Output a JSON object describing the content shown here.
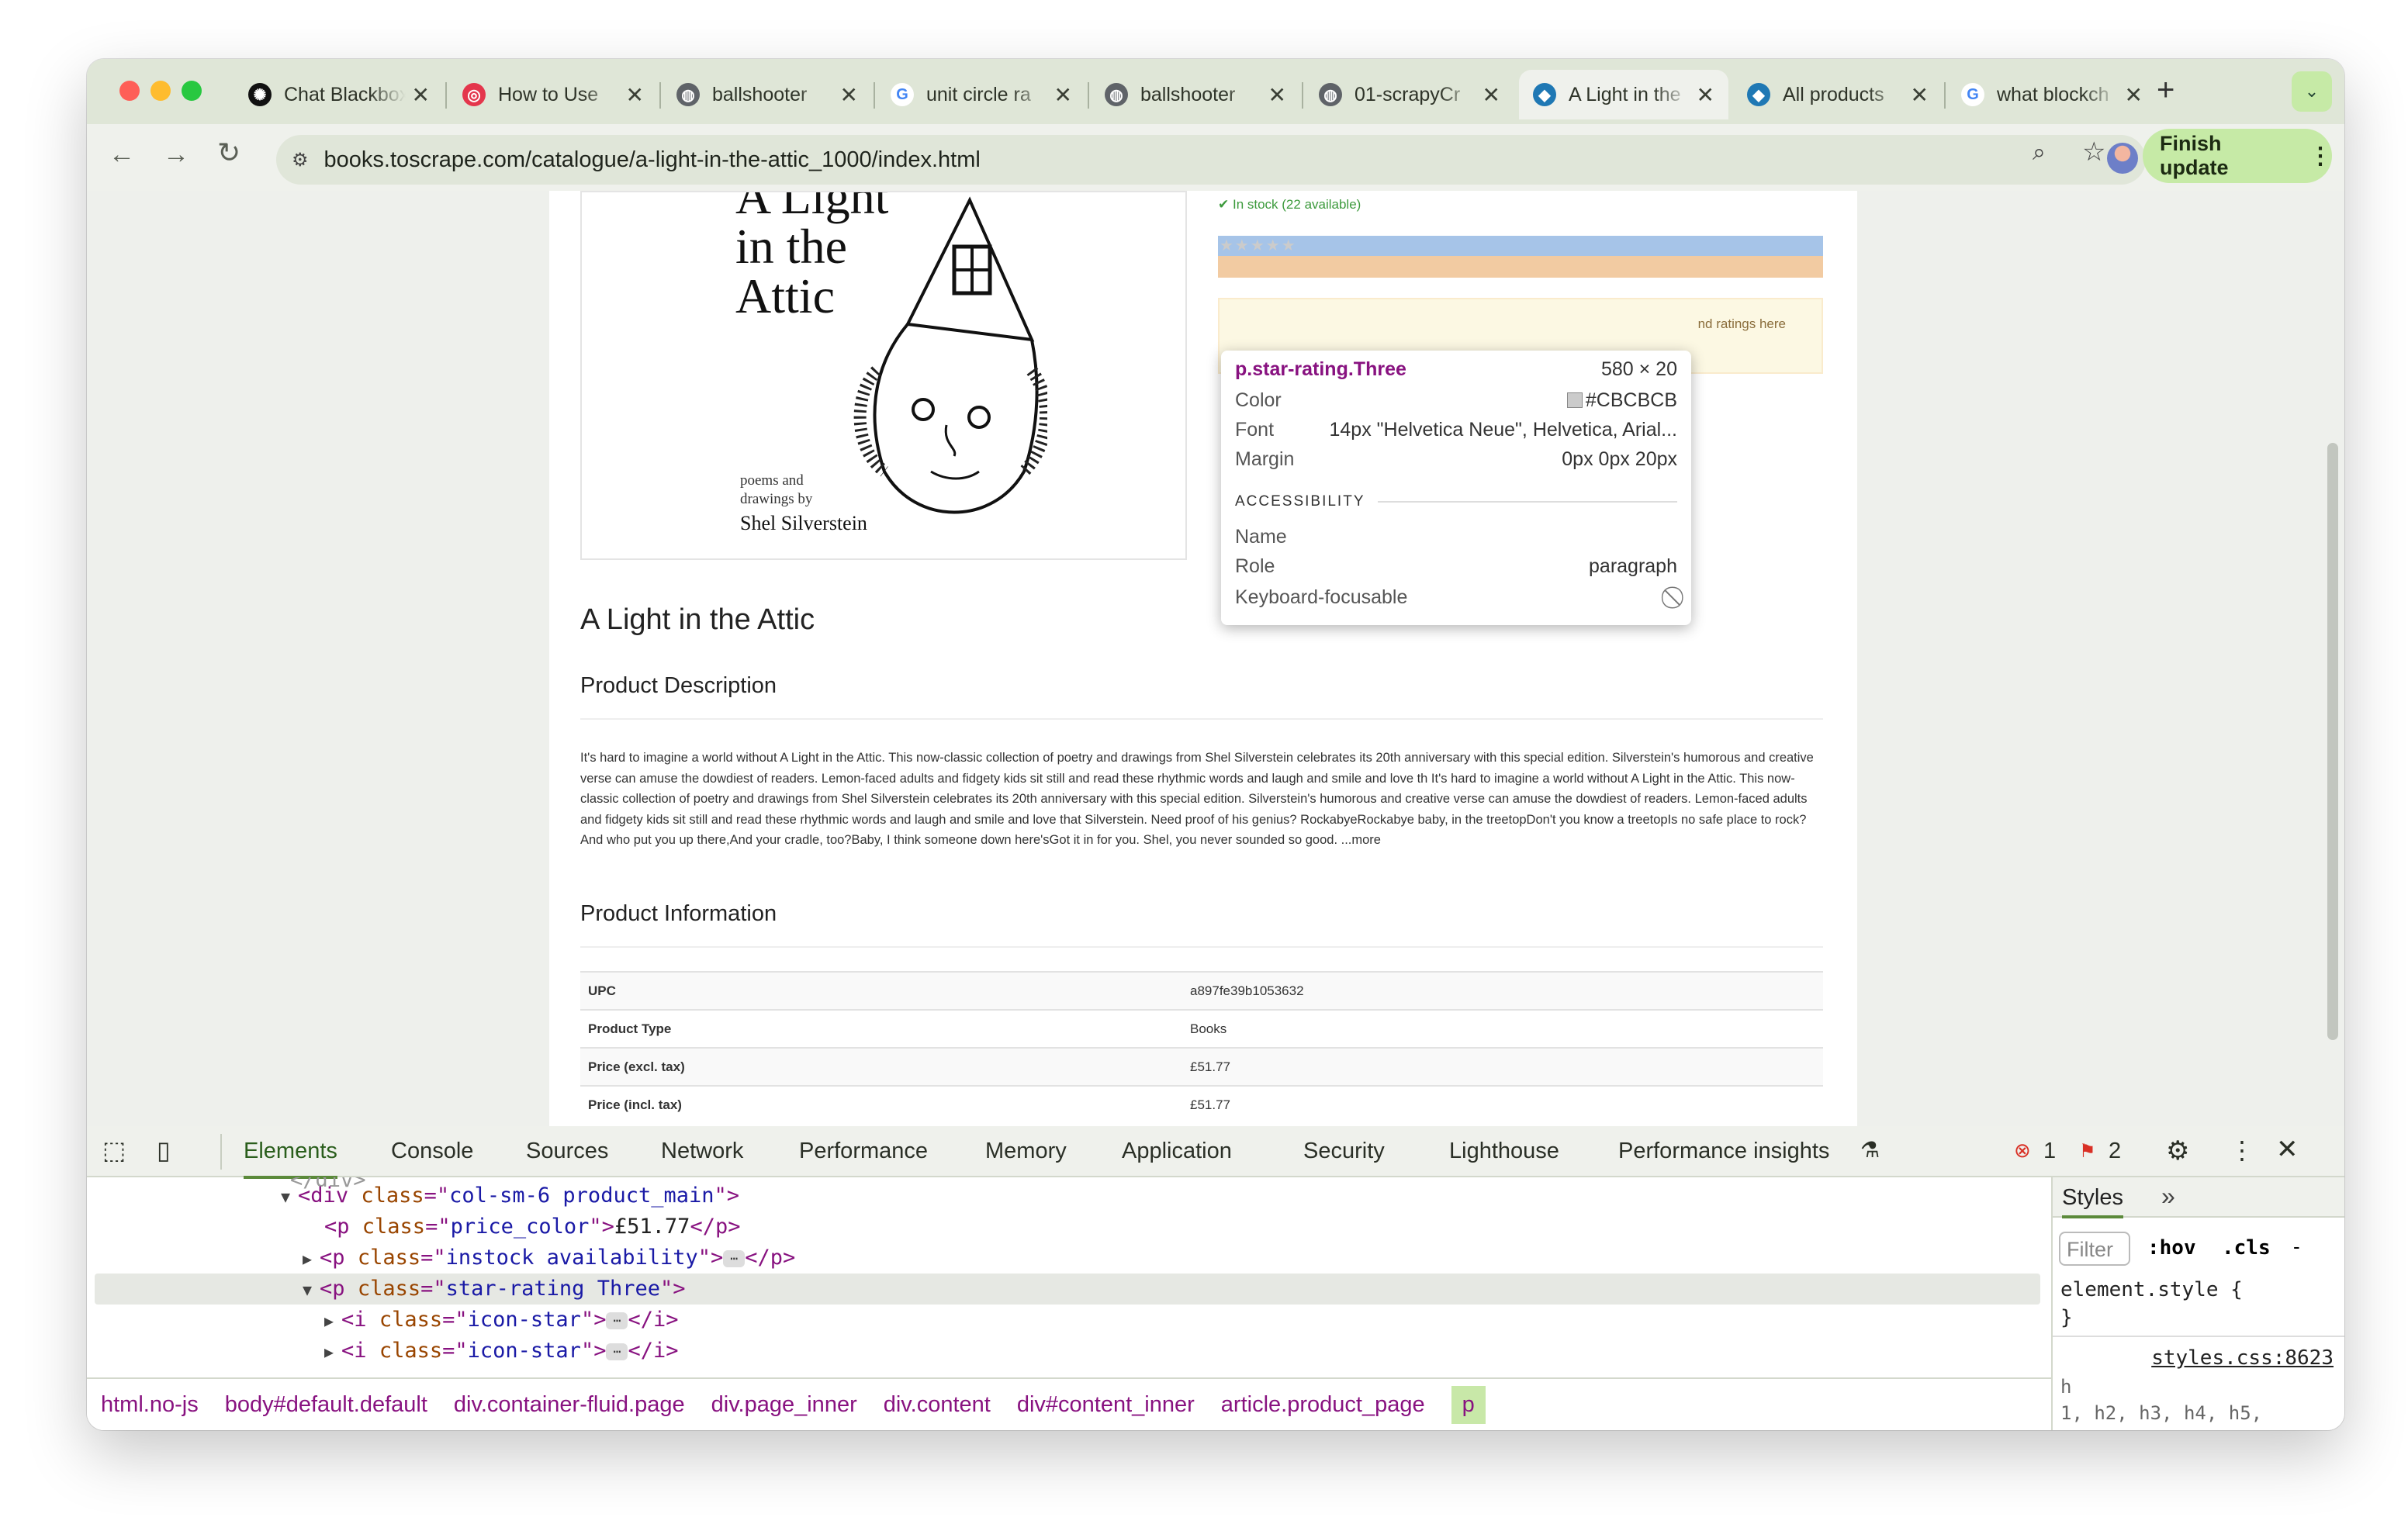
{
  "browser": {
    "tabs": [
      {
        "label": "Chat Blackbox",
        "icon": "blackbox-icon",
        "favbg": "#111111",
        "favfg": "#ffffff",
        "glyph": "✺"
      },
      {
        "label": "How to Use",
        "icon": "target-icon",
        "favbg": "#e4364c",
        "favfg": "#ffffff",
        "glyph": "◎"
      },
      {
        "label": "ballshooter",
        "icon": "globe-icon",
        "favbg": "#5f6368",
        "favfg": "#ffffff",
        "glyph": "◍"
      },
      {
        "label": "unit circle ra",
        "icon": "google-icon",
        "favbg": "#ffffff",
        "favfg": "#4285f4",
        "glyph": "G"
      },
      {
        "label": "ballshooter",
        "icon": "globe-icon",
        "favbg": "#5f6368",
        "favfg": "#ffffff",
        "glyph": "◍"
      },
      {
        "label": "01-scrapyCr",
        "icon": "globe-icon",
        "favbg": "#5f6368",
        "favfg": "#ffffff",
        "glyph": "◍"
      },
      {
        "label": "A Light in the",
        "icon": "site-icon",
        "favbg": "#1f78b4",
        "favfg": "#ffffff",
        "glyph": "◆"
      },
      {
        "label": "All products",
        "icon": "site-icon",
        "favbg": "#1f78b4",
        "favfg": "#ffffff",
        "glyph": "◆"
      },
      {
        "label": "what blockch",
        "icon": "google-icon",
        "favbg": "#ffffff",
        "favfg": "#4285f4",
        "glyph": "G"
      }
    ],
    "active_tab": 6,
    "url": "books.toscrape.com/catalogue/a-light-in-the-attic_1000/index.html",
    "finish_update": "Finish update"
  },
  "page": {
    "cover_title": [
      "A Light",
      "in the",
      "Attic"
    ],
    "cover_sub": [
      "poems and",
      "drawings by"
    ],
    "cover_author": "Shel Silverstein",
    "in_stock": "✔ In stock (22 available)",
    "stars": "★★★★★",
    "warning_partial": "nd ratings here",
    "title": "A Light in the Attic",
    "description_heading": "Product Description",
    "description": "It's hard to imagine a world without A Light in the Attic. This now-classic collection of poetry and drawings from Shel Silverstein celebrates its 20th anniversary with this special edition. Silverstein's humorous and creative verse can amuse the dowdiest of readers. Lemon-faced adults and fidgety kids sit still and read these rhythmic words and laugh and smile and love th It's hard to imagine a world without A Light in the Attic. This now-classic collection of poetry and drawings from Shel Silverstein celebrates its 20th anniversary with this special edition. Silverstein's humorous and creative verse can amuse the dowdiest of readers. Lemon-faced adults and fidgety kids sit still and read these rhythmic words and laugh and smile and love that Silverstein. Need proof of his genius? RockabyeRockabye baby, in the treetopDon't you know a treetopIs no safe place to rock?And who put you up there,And your cradle, too?Baby, I think someone down here'sGot it in for you. Shel, you never sounded so good. ...more",
    "info_heading": "Product Information",
    "info": [
      {
        "k": "UPC",
        "v": "a897fe39b1053632"
      },
      {
        "k": "Product Type",
        "v": "Books"
      },
      {
        "k": "Price (excl. tax)",
        "v": "£51.77"
      },
      {
        "k": "Price (incl. tax)",
        "v": "£51.77"
      }
    ]
  },
  "tooltip": {
    "selector": "p.star-rating.Three",
    "size": "580 × 20",
    "color_label": "Color",
    "color_value": "#CBCBCB",
    "color_swatch": "#cbcbcb",
    "font_label": "Font",
    "font_value": "14px \"Helvetica Neue\", Helvetica, Arial...",
    "margin_label": "Margin",
    "margin_value": "0px 0px 20px",
    "section": "ACCESSIBILITY",
    "name_label": "Name",
    "name_value": "",
    "role_label": "Role",
    "role_value": "paragraph",
    "kf_label": "Keyboard-focusable"
  },
  "devtools": {
    "tabs": [
      "Elements",
      "Console",
      "Sources",
      "Network",
      "Performance",
      "Memory",
      "Application",
      "Security",
      "Lighthouse",
      "Performance insights"
    ],
    "errors": "1",
    "warnings": "2",
    "code": {
      "l0_class": "col-sm-6 product_main",
      "l1_class": "price_color",
      "l1_text": "£51.77",
      "l2_class": "instock availability",
      "l3_class": "star-rating Three",
      "l4_class": "icon-star",
      "l5_class": "icon-star"
    },
    "breadcrumbs": [
      "html.no-js",
      "body#default.default",
      "div.container-fluid.page",
      "div.page_inner",
      "div.content",
      "div#content_inner",
      "article.product_page",
      "p"
    ],
    "styles": {
      "tab": "Styles",
      "filter": "Filter",
      "hov": ":hov",
      "cls": ".cls",
      "element_style": "element.style {",
      "close": "}",
      "source": "styles.css:8623",
      "rule1": "h",
      "rule2": "1, h2, h3, h4, h5,"
    }
  },
  "colors": {
    "accent": "#5b8a3a",
    "selector": "#881280",
    "attr": "#994500",
    "value": "#1a1aa6"
  }
}
